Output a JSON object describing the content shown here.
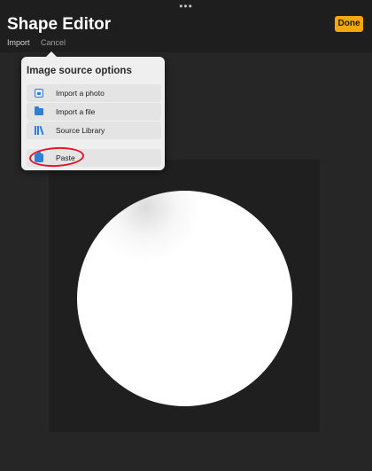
{
  "window": {
    "title": "Shape Editor",
    "grabber": "•••",
    "done_label": "Done"
  },
  "subnav": {
    "import_label": "Import",
    "cancel_label": "Cancel"
  },
  "popover": {
    "title": "Image source options",
    "items": [
      {
        "label": "Import a photo",
        "icon": "photo-icon"
      },
      {
        "label": "Import a file",
        "icon": "folder-icon"
      },
      {
        "label": "Source Library",
        "icon": "library-icon"
      },
      {
        "label": "Paste",
        "icon": "paste-icon"
      }
    ]
  },
  "colors": {
    "accent": "#f5a70f",
    "menu_icon": "#2e7fd8",
    "annotation": "#e0182b",
    "background": "#262626"
  }
}
